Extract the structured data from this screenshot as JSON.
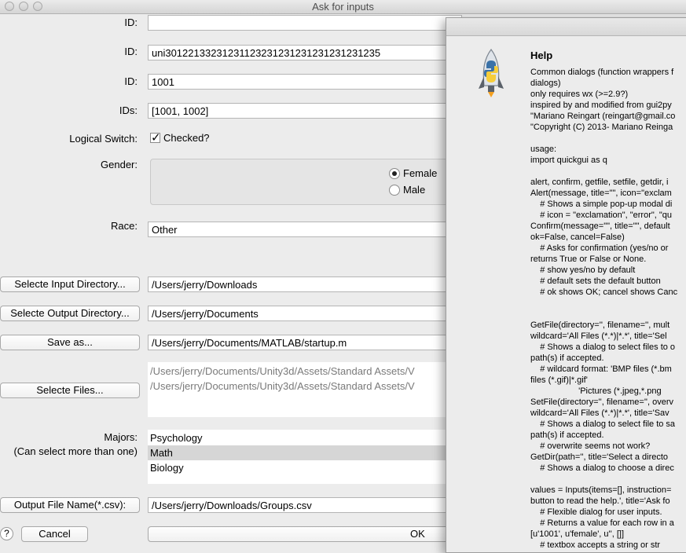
{
  "window": {
    "title": "Ask for inputs"
  },
  "fields": {
    "id1": {
      "label": "ID:",
      "value": ""
    },
    "id2": {
      "label": "ID:",
      "value": "uni30122133231231123231231231231231231235"
    },
    "id3": {
      "label": "ID:",
      "value": "1001"
    },
    "ids": {
      "label": "IDs:",
      "value": "[1001, 1002]"
    },
    "logical": {
      "label": "Logical Switch:",
      "checkbox_label": "Checked?"
    },
    "gender": {
      "label": "Gender:",
      "options": [
        "Female",
        "Male"
      ],
      "selected": "Female"
    },
    "race": {
      "label": "Race:",
      "value": "Other"
    },
    "input_dir": {
      "button": "Selecte Input Directory...",
      "value": "/Users/jerry/Downloads"
    },
    "output_dir": {
      "button": "Selecte Output Directory...",
      "value": "/Users/jerry/Documents"
    },
    "save_as": {
      "button": "Save as...",
      "value": "/Users/jerry/Documents/MATLAB/startup.m"
    },
    "files": {
      "button": "Selecte Files...",
      "values": [
        "/Users/jerry/Documents/Unity3d/Assets/Standard Assets/V",
        "/Users/jerry/Documents/Unity3d/Assets/Standard Assets/V"
      ]
    },
    "majors": {
      "label": "Majors:",
      "label2": "(Can select more than one)",
      "items": [
        "Psychology",
        "Math",
        "Biology"
      ],
      "selected": "Math"
    },
    "output_file": {
      "button": "Output File Name(*.csv):",
      "value": "/Users/jerry/Downloads/Groups.csv"
    }
  },
  "footer": {
    "help": "?",
    "cancel": "Cancel",
    "ok": "OK"
  },
  "help": {
    "title": "Help",
    "text": "Common dialogs (function wrappers f\ndialogs)\nonly requires wx (>=2.9?)\ninspired by and modified from gui2py\n\"Mariano Reingart (reingart@gmail.co\n\"Copyright (C) 2013- Mariano Reinga\n\nusage:\nimport quickgui as q\n\nalert, confirm, getfile, setfile, getdir, i\nAlert(message, title=\"\", icon=\"exclam\n    # Shows a simple pop-up modal di\n    # icon = \"exclamation\", \"error\", \"qu\nConfirm(message=\"\", title=\"\", default\nok=False, cancel=False)\n    # Asks for confirmation (yes/no or\nreturns True or False or None.\n    # show yes/no by default\n    # default sets the default button\n    # ok shows OK; cancel shows Canc\n\n\nGetFile(directory='', filename='', mult\nwildcard='All Files (*.*)|*.*', title='Sel\n    # Shows a dialog to select files to o\npath(s) if accepted.\n    # wildcard format: 'BMP files (*.bm\nfiles (*.gif)|*.gif'\n                    'Pictures (*.jpeg,*.png\nSetFile(directory='', filename='', overv\nwildcard='All Files (*.*)|*.*', title='Sav\n    # Shows a dialog to select file to sa\npath(s) if accepted.\n    # overwrite seems not work?\nGetDir(path='', title='Select a directo\n    # Shows a dialog to choose a direc\n\nvalues = Inputs(items=[], instruction=\nbutton to read the help.', title='Ask fo\n    # Flexible dialog for user inputs.\n    # Returns a value for each row in a\n[u'1001', u'female', u'', []]\n    # textbox accepts a string or str"
  }
}
